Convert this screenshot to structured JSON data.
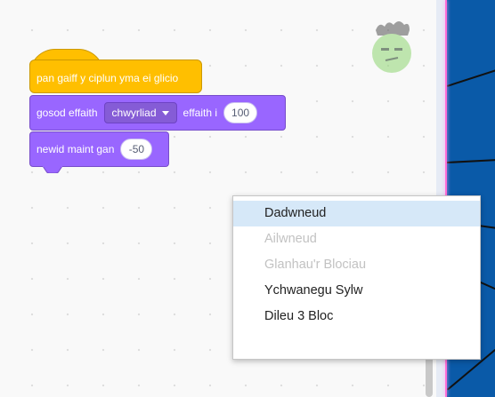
{
  "blocks": {
    "hat_label": "pan gaiff y ciplun yma ei glicio",
    "effect_block": {
      "set_label": "gosod effaith",
      "effect_value": "chwyrliad",
      "to_label": "effaith i",
      "amount": "100"
    },
    "size_block": {
      "label": "newid maint gan",
      "amount": "-50"
    }
  },
  "context_menu": {
    "items": [
      {
        "label": "Dadwneud",
        "state": "highlighted"
      },
      {
        "label": "Ailwneud",
        "state": "disabled"
      },
      {
        "label": "Glanhau'r Blociau",
        "state": "disabled"
      },
      {
        "label": "Ychwanegu Sylw",
        "state": "enabled"
      },
      {
        "label": "Dileu 3 Bloc",
        "state": "enabled"
      }
    ]
  },
  "sprite": {
    "icon": "sprite-thumbnail-icon"
  },
  "colors": {
    "events": "#ffbf00",
    "looks": "#9966ff",
    "menu_highlight": "#d6e8f8",
    "stage": "#0a5aa8"
  }
}
